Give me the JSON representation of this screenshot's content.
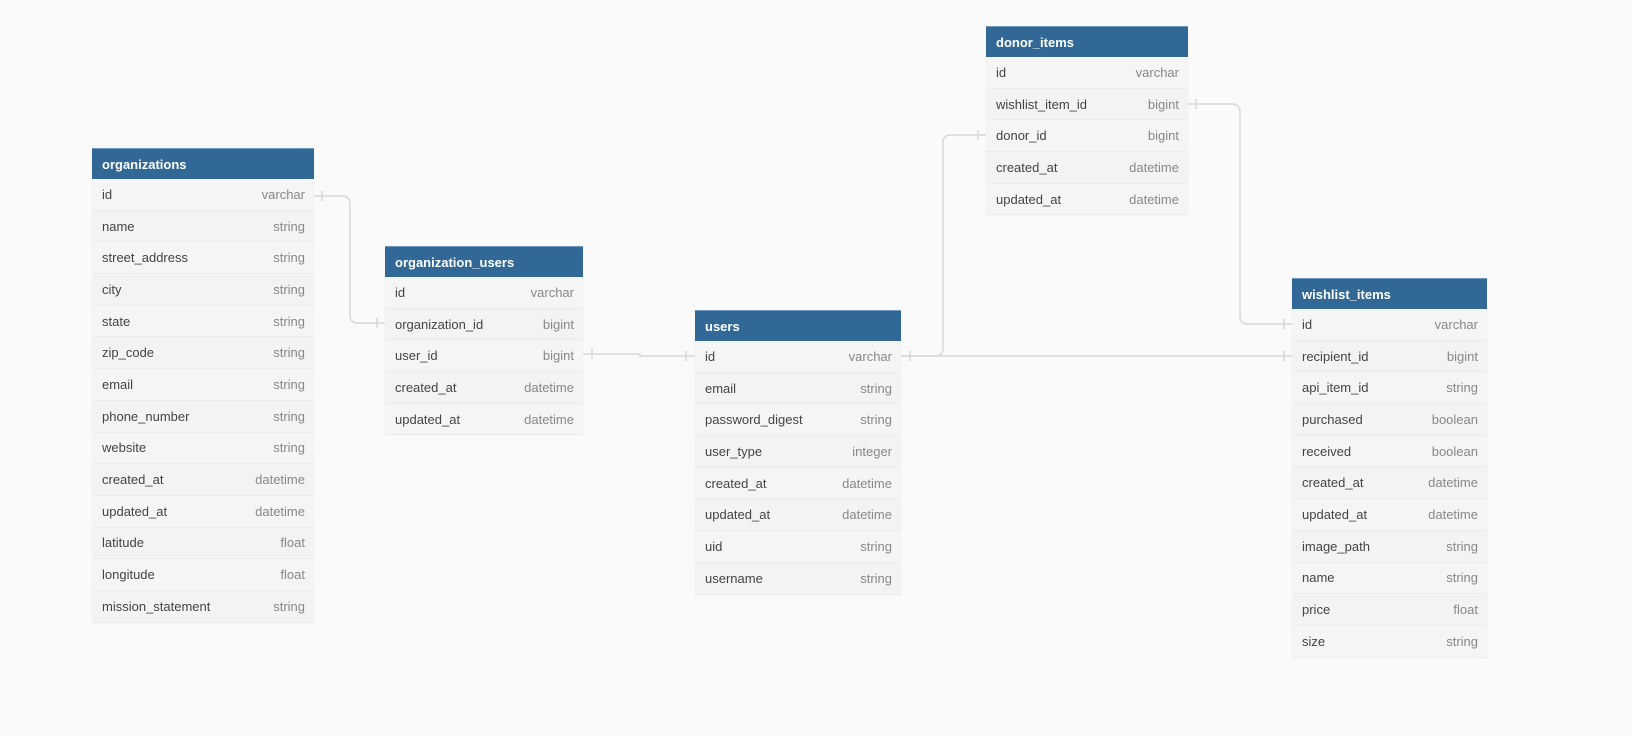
{
  "tables": [
    {
      "name": "organizations",
      "fields": [
        [
          "id",
          "varchar"
        ],
        [
          "name",
          "string"
        ],
        [
          "street_address",
          "string"
        ],
        [
          "city",
          "string"
        ],
        [
          "state",
          "string"
        ],
        [
          "zip_code",
          "string"
        ],
        [
          "email",
          "string"
        ],
        [
          "phone_number",
          "string"
        ],
        [
          "website",
          "string"
        ],
        [
          "created_at",
          "datetime"
        ],
        [
          "updated_at",
          "datetime"
        ],
        [
          "latitude",
          "float"
        ],
        [
          "longitude",
          "float"
        ],
        [
          "mission_statement",
          "string"
        ]
      ]
    },
    {
      "name": "organization_users",
      "fields": [
        [
          "id",
          "varchar"
        ],
        [
          "organization_id",
          "bigint"
        ],
        [
          "user_id",
          "bigint"
        ],
        [
          "created_at",
          "datetime"
        ],
        [
          "updated_at",
          "datetime"
        ]
      ]
    },
    {
      "name": "users",
      "fields": [
        [
          "id",
          "varchar"
        ],
        [
          "email",
          "string"
        ],
        [
          "password_digest",
          "string"
        ],
        [
          "user_type",
          "integer"
        ],
        [
          "created_at",
          "datetime"
        ],
        [
          "updated_at",
          "datetime"
        ],
        [
          "uid",
          "string"
        ],
        [
          "username",
          "string"
        ]
      ]
    },
    {
      "name": "donor_items",
      "fields": [
        [
          "id",
          "varchar"
        ],
        [
          "wishlist_item_id",
          "bigint"
        ],
        [
          "donor_id",
          "bigint"
        ],
        [
          "created_at",
          "datetime"
        ],
        [
          "updated_at",
          "datetime"
        ]
      ]
    },
    {
      "name": "wishlist_items",
      "fields": [
        [
          "id",
          "varchar"
        ],
        [
          "recipient_id",
          "bigint"
        ],
        [
          "api_item_id",
          "string"
        ],
        [
          "purchased",
          "boolean"
        ],
        [
          "received",
          "boolean"
        ],
        [
          "created_at",
          "datetime"
        ],
        [
          "updated_at",
          "datetime"
        ],
        [
          "image_path",
          "string"
        ],
        [
          "name",
          "string"
        ],
        [
          "price",
          "float"
        ],
        [
          "size",
          "string"
        ]
      ]
    }
  ],
  "relationships": [
    {
      "from": "organizations.id",
      "to": "organization_users.organization_id"
    },
    {
      "from": "users.id",
      "to": "organization_users.user_id"
    },
    {
      "from": "users.id",
      "to": "donor_items.donor_id"
    },
    {
      "from": "users.id",
      "to": "wishlist_items.recipient_id"
    },
    {
      "from": "wishlist_items.id",
      "to": "donor_items.wishlist_item_id"
    }
  ],
  "colors": {
    "header": "#316896",
    "background": "#fafafa",
    "link": "#d8d8d8"
  }
}
